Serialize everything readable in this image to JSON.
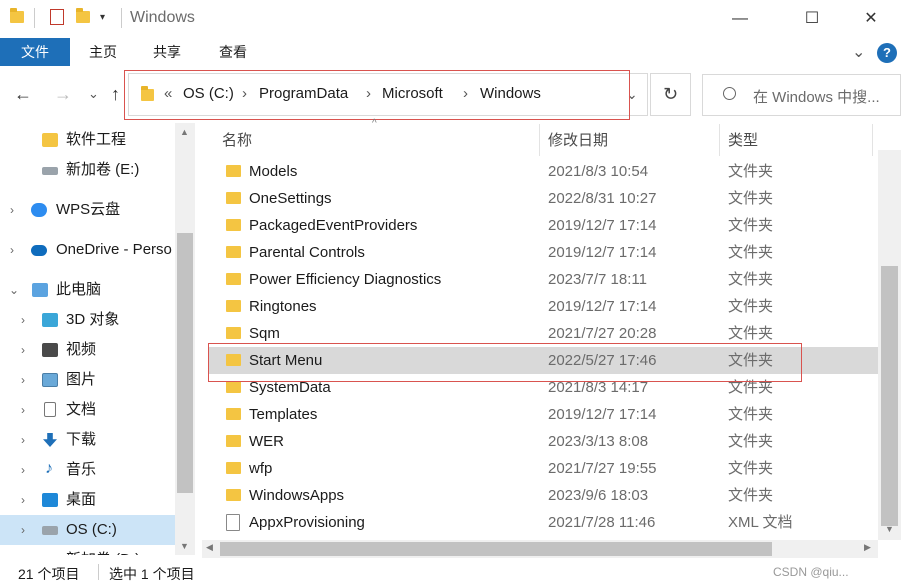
{
  "window": {
    "title": "Windows",
    "min_glyph": "—",
    "max_glyph": "☐",
    "close_glyph": "✕"
  },
  "ribbon": {
    "tabs": [
      "文件",
      "主页",
      "共享",
      "查看"
    ],
    "expand_glyph": "⌄",
    "help_glyph": "?"
  },
  "nav": {
    "back_glyph": "←",
    "forward_glyph": "→",
    "recent_glyph": "⌄",
    "up_glyph": "↑"
  },
  "address": {
    "overflow": "«",
    "crumbs": [
      "OS (C:)",
      "ProgramData",
      "Microsoft",
      "Windows"
    ],
    "sep": "›",
    "dropdown_glyph": "⌄",
    "refresh_glyph": "↻"
  },
  "search": {
    "placeholder": "在 Windows 中搜..."
  },
  "sidebar": {
    "items": [
      {
        "label": "软件工程",
        "icon": "folder-icon",
        "chev": ""
      },
      {
        "label": "新加卷 (E:)",
        "icon": "drive-icon",
        "chev": ""
      },
      {
        "label": "WPS云盘",
        "icon": "cloud-icon",
        "chev": "›"
      },
      {
        "label": "OneDrive - Perso",
        "icon": "onedrive-icon",
        "chev": "›"
      },
      {
        "label": "此电脑",
        "icon": "pc-icon",
        "chev": "⌄"
      },
      {
        "label": "3D 对象",
        "icon": "3d-icon",
        "chev": "›"
      },
      {
        "label": "视频",
        "icon": "video-icon",
        "chev": "›"
      },
      {
        "label": "图片",
        "icon": "picture-icon",
        "chev": "›"
      },
      {
        "label": "文档",
        "icon": "document-icon",
        "chev": "›"
      },
      {
        "label": "下载",
        "icon": "download-icon",
        "chev": "›"
      },
      {
        "label": "音乐",
        "icon": "music-icon",
        "chev": "›"
      },
      {
        "label": "桌面",
        "icon": "desktop-icon",
        "chev": "›"
      },
      {
        "label": "OS (C:)",
        "icon": "os-drive-icon",
        "chev": "›"
      },
      {
        "label": "新加卷 (D:)",
        "icon": "drive-icon",
        "chev": "›"
      }
    ]
  },
  "columns": {
    "name": "名称",
    "date": "修改日期",
    "type": "类型"
  },
  "files": [
    {
      "name": "Models",
      "date": "2021/8/3 10:54",
      "type": "文件夹",
      "kind": "folder"
    },
    {
      "name": "OneSettings",
      "date": "2022/8/31 10:27",
      "type": "文件夹",
      "kind": "folder"
    },
    {
      "name": "PackagedEventProviders",
      "date": "2019/12/7 17:14",
      "type": "文件夹",
      "kind": "folder"
    },
    {
      "name": "Parental Controls",
      "date": "2019/12/7 17:14",
      "type": "文件夹",
      "kind": "folder"
    },
    {
      "name": "Power Efficiency Diagnostics",
      "date": "2023/7/7 18:11",
      "type": "文件夹",
      "kind": "folder"
    },
    {
      "name": "Ringtones",
      "date": "2019/12/7 17:14",
      "type": "文件夹",
      "kind": "folder"
    },
    {
      "name": "Sqm",
      "date": "2021/7/27 20:28",
      "type": "文件夹",
      "kind": "folder"
    },
    {
      "name": "Start Menu",
      "date": "2022/5/27 17:46",
      "type": "文件夹",
      "kind": "folder",
      "selected": true
    },
    {
      "name": "SystemData",
      "date": "2021/8/3 14:17",
      "type": "文件夹",
      "kind": "folder"
    },
    {
      "name": "Templates",
      "date": "2019/12/7 17:14",
      "type": "文件夹",
      "kind": "folder"
    },
    {
      "name": "WER",
      "date": "2023/3/13 8:08",
      "type": "文件夹",
      "kind": "folder"
    },
    {
      "name": "wfp",
      "date": "2021/7/27 19:55",
      "type": "文件夹",
      "kind": "folder"
    },
    {
      "name": "WindowsApps",
      "date": "2023/9/6 18:03",
      "type": "文件夹",
      "kind": "folder"
    },
    {
      "name": "AppxProvisioning",
      "date": "2021/7/28 11:46",
      "type": "XML 文档",
      "kind": "file"
    }
  ],
  "status": {
    "count": "21 个项目",
    "selection": "选中 1 个项目",
    "watermark": "CSDN @qiu..."
  },
  "colors": {
    "accent": "#1e6fb8",
    "folder": "#f4c542",
    "highlight_box": "#d9534f",
    "selection": "#d9d9d9"
  }
}
